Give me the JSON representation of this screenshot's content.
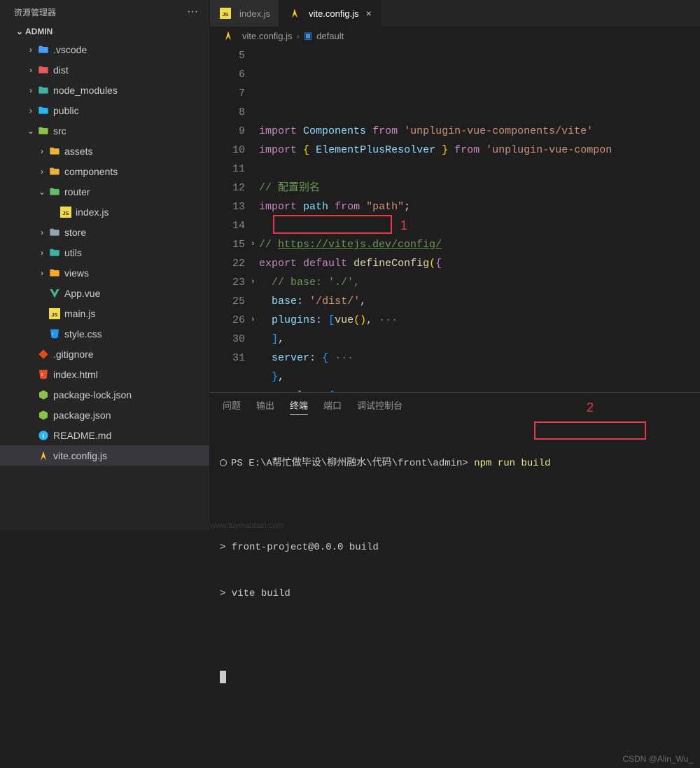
{
  "sidebar": {
    "title": "资源管理器",
    "project": "ADMIN",
    "items": [
      {
        "label": ".vscode",
        "icon": "folder-blue",
        "indent": 2,
        "chev": "right"
      },
      {
        "label": "dist",
        "icon": "folder-red",
        "indent": 2,
        "chev": "right"
      },
      {
        "label": "node_modules",
        "icon": "folder-teal",
        "indent": 2,
        "chev": "right"
      },
      {
        "label": "public",
        "icon": "folder-cyan",
        "indent": 2,
        "chev": "right"
      },
      {
        "label": "src",
        "icon": "folder-green",
        "indent": 2,
        "chev": "down"
      },
      {
        "label": "assets",
        "icon": "folder-yellow",
        "indent": 3,
        "chev": "right"
      },
      {
        "label": "components",
        "icon": "folder-yellow",
        "indent": 3,
        "chev": "right"
      },
      {
        "label": "router",
        "icon": "folder-green-open",
        "indent": 3,
        "chev": "down"
      },
      {
        "label": "index.js",
        "icon": "js",
        "indent": 4,
        "chev": ""
      },
      {
        "label": "store",
        "icon": "folder-gray",
        "indent": 3,
        "chev": "right"
      },
      {
        "label": "utils",
        "icon": "folder-teal",
        "indent": 3,
        "chev": "right"
      },
      {
        "label": "views",
        "icon": "folder-orange",
        "indent": 3,
        "chev": "right"
      },
      {
        "label": "App.vue",
        "icon": "vue",
        "indent": 3,
        "chev": ""
      },
      {
        "label": "main.js",
        "icon": "js",
        "indent": 3,
        "chev": ""
      },
      {
        "label": "style.css",
        "icon": "css",
        "indent": 3,
        "chev": ""
      },
      {
        "label": ".gitignore",
        "icon": "git",
        "indent": 2,
        "chev": ""
      },
      {
        "label": "index.html",
        "icon": "html",
        "indent": 2,
        "chev": ""
      },
      {
        "label": "package-lock.json",
        "icon": "node",
        "indent": 2,
        "chev": ""
      },
      {
        "label": "package.json",
        "icon": "node",
        "indent": 2,
        "chev": ""
      },
      {
        "label": "README.md",
        "icon": "info",
        "indent": 2,
        "chev": ""
      },
      {
        "label": "vite.config.js",
        "icon": "vite",
        "indent": 2,
        "chev": "",
        "selected": true
      }
    ]
  },
  "tabs": [
    {
      "label": "index.js",
      "icon": "js",
      "active": false
    },
    {
      "label": "vite.config.js",
      "icon": "vite",
      "active": true
    }
  ],
  "breadcrumb": {
    "file": "vite.config.js",
    "symbol": "default"
  },
  "code": {
    "lines": [
      {
        "n": 5,
        "html": "<span class='kw'>import</span> <span class='id'>Components</span> <span class='kw'>from</span> <span class='str'>'unplugin-vue-components/vite'</span>"
      },
      {
        "n": 6,
        "html": "<span class='kw'>import</span> <span class='br'>{</span> <span class='id'>ElementPlusResolver</span> <span class='br'>}</span> <span class='kw'>from</span> <span class='str'>'unplugin-vue-compon</span>"
      },
      {
        "n": 7,
        "html": ""
      },
      {
        "n": 8,
        "html": "<span class='cm'>// 配置别名</span>"
      },
      {
        "n": 9,
        "html": "<span class='kw'>import</span> <span class='id'>path</span> <span class='kw'>from</span> <span class='str'>\"path\"</span><span class='pn'>;</span>"
      },
      {
        "n": 10,
        "html": ""
      },
      {
        "n": 11,
        "html": "<span class='cm'>// <span class='lnk'>https://vitejs.dev/config/</span></span>"
      },
      {
        "n": 12,
        "html": "<span class='kw'>export</span> <span class='kw'>default</span> <span class='fn'>defineConfig</span><span class='br'>(</span><span class='br2'>{</span>"
      },
      {
        "n": 13,
        "html": "  <span class='cm'>// base: './',</span>"
      },
      {
        "n": 14,
        "html": "  <span class='id'>base</span><span class='pn'>:</span> <span class='str'>'/dist/'</span><span class='pn'>,</span>"
      },
      {
        "n": 15,
        "html": "  <span class='id'>plugins</span><span class='pn'>:</span> <span class='br3'>[</span><span class='fn'>vue</span><span class='br'>()</span><span class='pn'>,</span><span class='cm'> ···</span>",
        "fold": true
      },
      {
        "n": 22,
        "html": "  <span class='br3'>]</span><span class='pn'>,</span>"
      },
      {
        "n": 23,
        "html": "  <span class='id'>server</span><span class='pn'>:</span> <span class='br3'>{</span><span class='cm'> ···</span>",
        "fold": true
      },
      {
        "n": 25,
        "html": "  <span class='br3'>}</span><span class='pn'>,</span>"
      },
      {
        "n": 26,
        "html": "  <span class='id'>resolve</span><span class='pn'>:</span> <span class='br3'>{</span><span class='cm'> ···</span>",
        "fold": true
      },
      {
        "n": 30,
        "html": "  <span class='br3'>}</span><span class='pn'>,</span>"
      },
      {
        "n": 31,
        "html": ""
      }
    ]
  },
  "panel": {
    "tabs": [
      "问题",
      "输出",
      "终端",
      "端口",
      "调试控制台"
    ],
    "active_tab": 2,
    "terminal": {
      "prompt_prefix": "PS E:\\A帮忙做毕设\\柳州融水\\代码\\front\\admin>",
      "command": "npm run build",
      "output": [
        "> front-project@0.0.0 build",
        "> vite build"
      ]
    }
  },
  "annotations": {
    "box1_label": "1",
    "box2_label": "2"
  },
  "watermark": "CSDN @Alin_Wu_",
  "watermark_left": "www.tuymaoban.com"
}
